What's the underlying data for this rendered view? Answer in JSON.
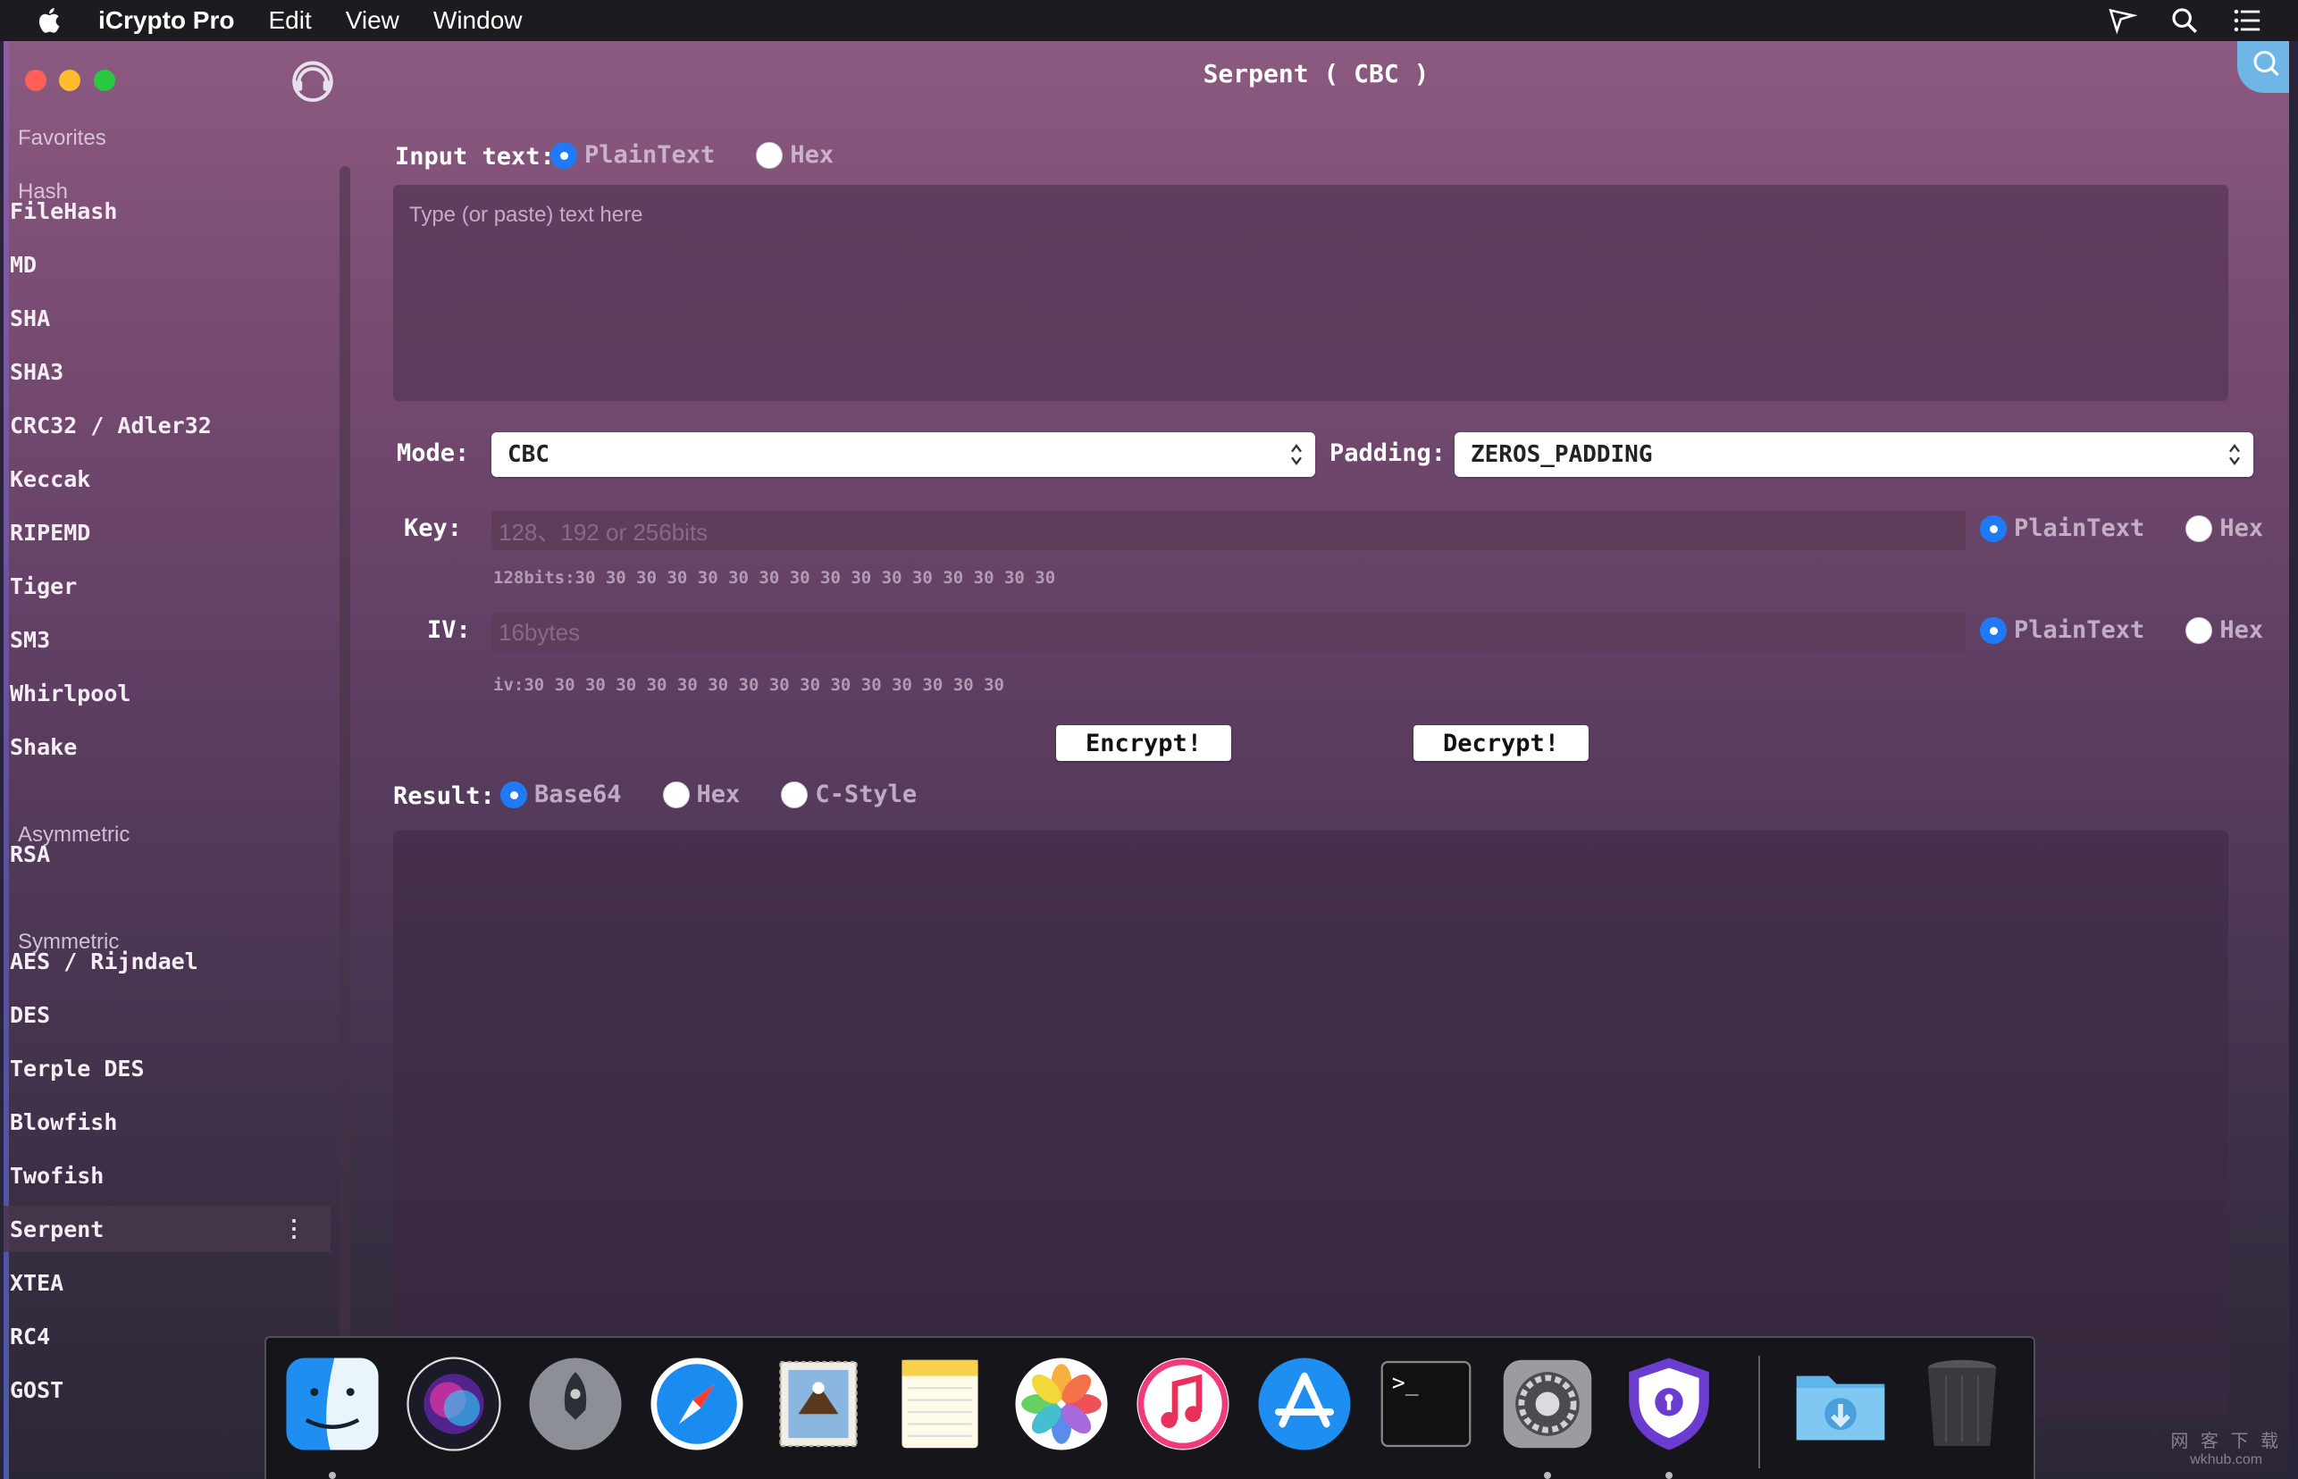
{
  "menubar": {
    "app_name": "iCrypto Pro",
    "menus": [
      "Edit",
      "View",
      "Window"
    ]
  },
  "window": {
    "title": "Serpent ( CBC )"
  },
  "sidebar": {
    "sections": {
      "favorites": "Favorites",
      "hash": "Hash",
      "asymmetric": "Asymmetric",
      "symmetric": "Symmetric"
    },
    "hash_items": [
      "FileHash",
      "MD",
      "SHA",
      "SHA3",
      "CRC32 / Adler32",
      "Keccak",
      "RIPEMD",
      "Tiger",
      "SM3",
      "Whirlpool",
      "Shake"
    ],
    "asymmetric_items": [
      "RSA"
    ],
    "symmetric_items": [
      "AES / Rijndael",
      "DES",
      "Terple DES",
      "Blowfish",
      "Twofish",
      "Serpent",
      "XTEA",
      "RC4",
      "GOST"
    ],
    "selected": "Serpent",
    "more_glyph": "⋮"
  },
  "input": {
    "label": "Input text:",
    "options": [
      "PlainText",
      "Hex"
    ],
    "selected": "PlainText",
    "placeholder": "Type (or paste) text here"
  },
  "mode": {
    "label": "Mode:",
    "value": "CBC"
  },
  "padding": {
    "label": "Padding:",
    "value": "ZEROS_PADDING"
  },
  "key": {
    "label": "Key:",
    "placeholder": "128、192 or 256bits",
    "hint": "128bits:30 30 30 30 30 30 30 30 30 30 30 30 30 30 30 30",
    "options": [
      "PlainText",
      "Hex"
    ],
    "selected": "PlainText"
  },
  "iv": {
    "label": "IV:",
    "placeholder": "16bytes",
    "hint": "iv:30 30 30 30 30 30 30 30 30 30 30 30 30 30 30 30",
    "options": [
      "PlainText",
      "Hex"
    ],
    "selected": "PlainText"
  },
  "actions": {
    "encrypt": "Encrypt!",
    "decrypt": "Decrypt!"
  },
  "result": {
    "label": "Result:",
    "options": [
      "Base64",
      "Hex",
      "C-Style"
    ],
    "selected": "Base64"
  },
  "dock": {
    "apps": [
      "finder-icon",
      "siri-icon",
      "launchpad-icon",
      "safari-icon",
      "mail-icon",
      "notes-icon",
      "photos-icon",
      "music-icon",
      "app-store-icon",
      "terminal-icon",
      "system-preferences-icon",
      "icrypto-icon",
      "downloads-folder-icon",
      "trash-icon"
    ],
    "terminal_prompt": ">_"
  },
  "watermark": {
    "line1": "网 客 下 载",
    "line2": "wkhub.com"
  },
  "colors": {
    "accent_radio": "#1f7af5",
    "close": "#fe5f57",
    "minimize": "#febc2e",
    "maximize": "#28c840"
  }
}
